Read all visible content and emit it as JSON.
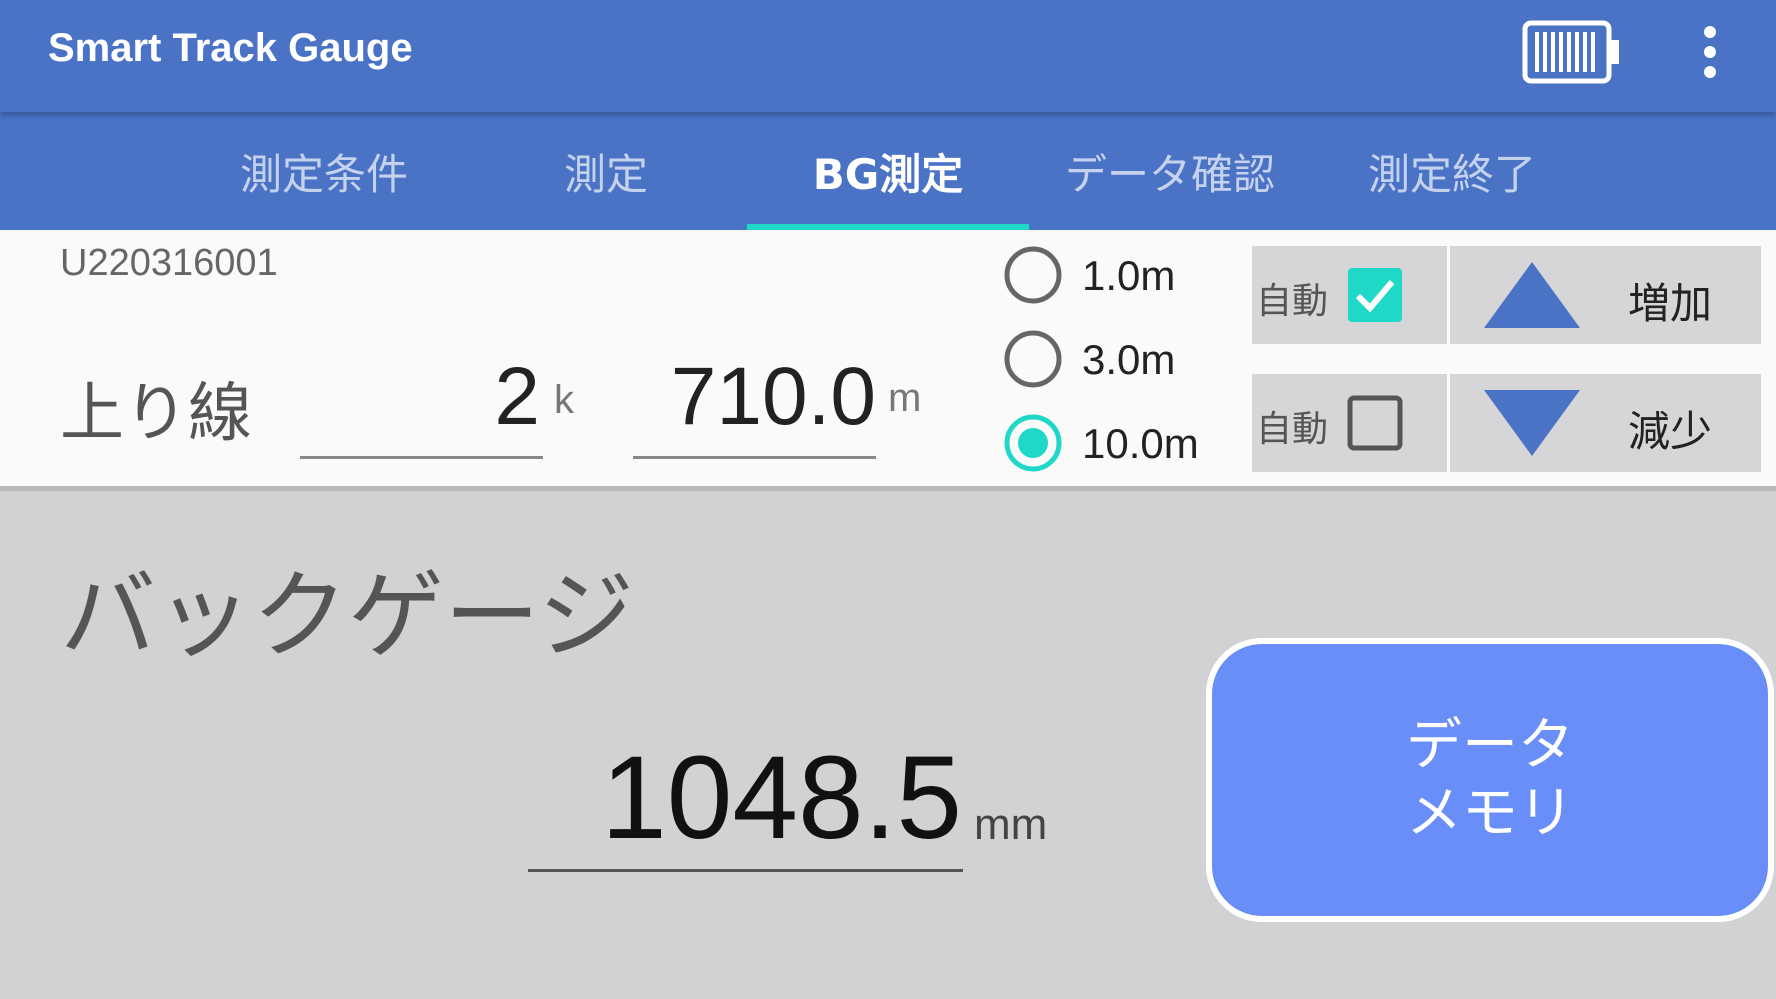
{
  "appbar": {
    "title": "Smart Track Gauge",
    "battery_icon": "battery-full-icon",
    "menu_icon": "more-vert-icon"
  },
  "tabs": [
    {
      "label": "測定条件",
      "active": false
    },
    {
      "label": "測定",
      "active": false
    },
    {
      "label": "BG測定",
      "active": true
    },
    {
      "label": "データ確認",
      "active": false
    },
    {
      "label": "測定終了",
      "active": false
    }
  ],
  "position": {
    "device_id": "U220316001",
    "line_name": "上り線",
    "km_value": "2",
    "km_unit": "k",
    "m_value": "710.0",
    "m_unit": "m"
  },
  "interval": {
    "options": [
      {
        "label": "1.0m",
        "selected": false
      },
      {
        "label": "3.0m",
        "selected": false
      },
      {
        "label": "10.0m",
        "selected": true
      }
    ]
  },
  "controls": {
    "increase": {
      "auto_label": "自動",
      "auto_checked": true,
      "label": "増加",
      "icon": "arrow-up-icon"
    },
    "decrease": {
      "auto_label": "自動",
      "auto_checked": false,
      "label": "減少",
      "icon": "arrow-down-icon"
    }
  },
  "backgauge": {
    "title": "バックゲージ",
    "value": "1048.5",
    "unit": "mm"
  },
  "memory_button": {
    "line1": "データ",
    "line2": "メモリ"
  },
  "colors": {
    "appbar": "#4a73c6",
    "tab_indicator": "#20d8c8",
    "checkbox_checked": "#20d8c8",
    "arrow": "#4a73c6",
    "memory_button": "#6a8ef7"
  }
}
